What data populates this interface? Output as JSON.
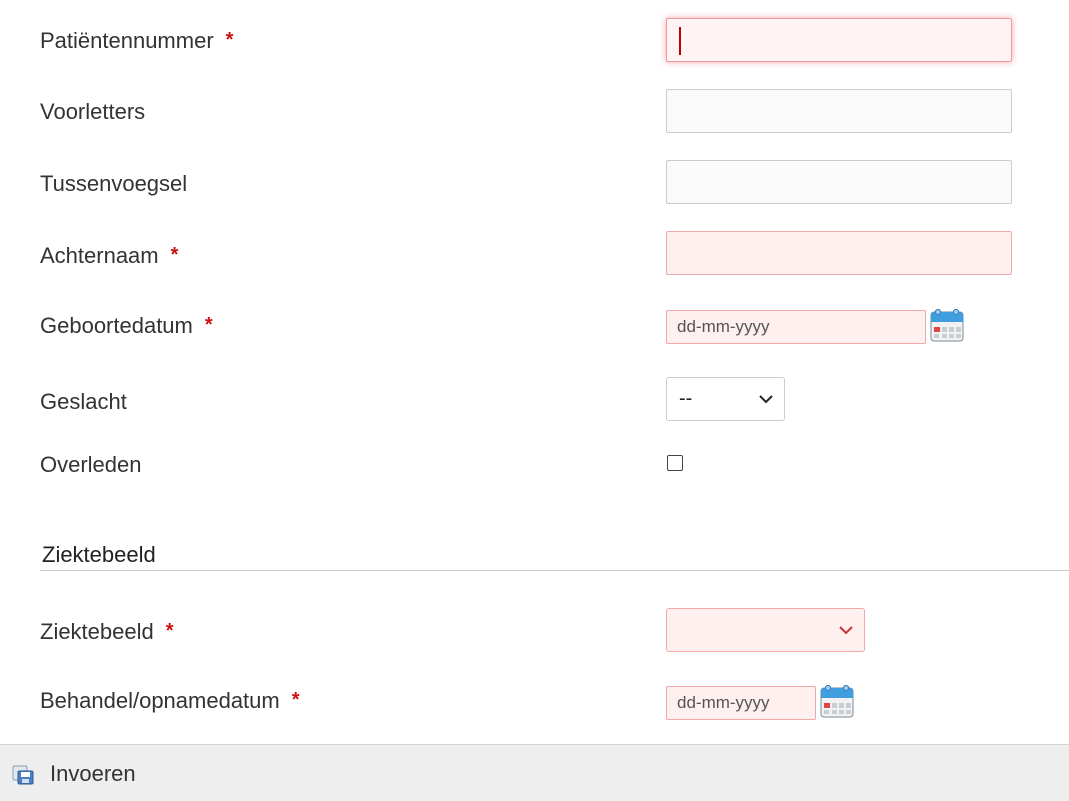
{
  "form": {
    "required_marker": "*",
    "patient_number": {
      "label": "Patiëntennummer",
      "value": ""
    },
    "initials": {
      "label": "Voorletters",
      "value": ""
    },
    "infix": {
      "label": "Tussenvoegsel",
      "value": ""
    },
    "last_name": {
      "label": "Achternaam",
      "value": ""
    },
    "birth_date": {
      "label": "Geboortedatum",
      "placeholder": "dd-mm-yyyy"
    },
    "gender": {
      "label": "Geslacht",
      "selected": "--"
    },
    "deceased": {
      "label": "Overleden",
      "checked": false
    }
  },
  "section": {
    "title": "Ziektebeeld",
    "disease": {
      "label": "Ziektebeeld",
      "selected": ""
    },
    "treatment_date": {
      "label": "Behandel/opnamedatum",
      "placeholder": "dd-mm-yyyy"
    }
  },
  "footer": {
    "save_label": "Invoeren"
  },
  "icons": {
    "calendar": "calendar-icon",
    "chevron": "chevron-down-icon",
    "save": "save-icon"
  },
  "colors": {
    "required": "#cc1111",
    "error_border": "#f0a8a8",
    "error_background": "#fff0f0",
    "footer_background": "#eeeeee"
  }
}
